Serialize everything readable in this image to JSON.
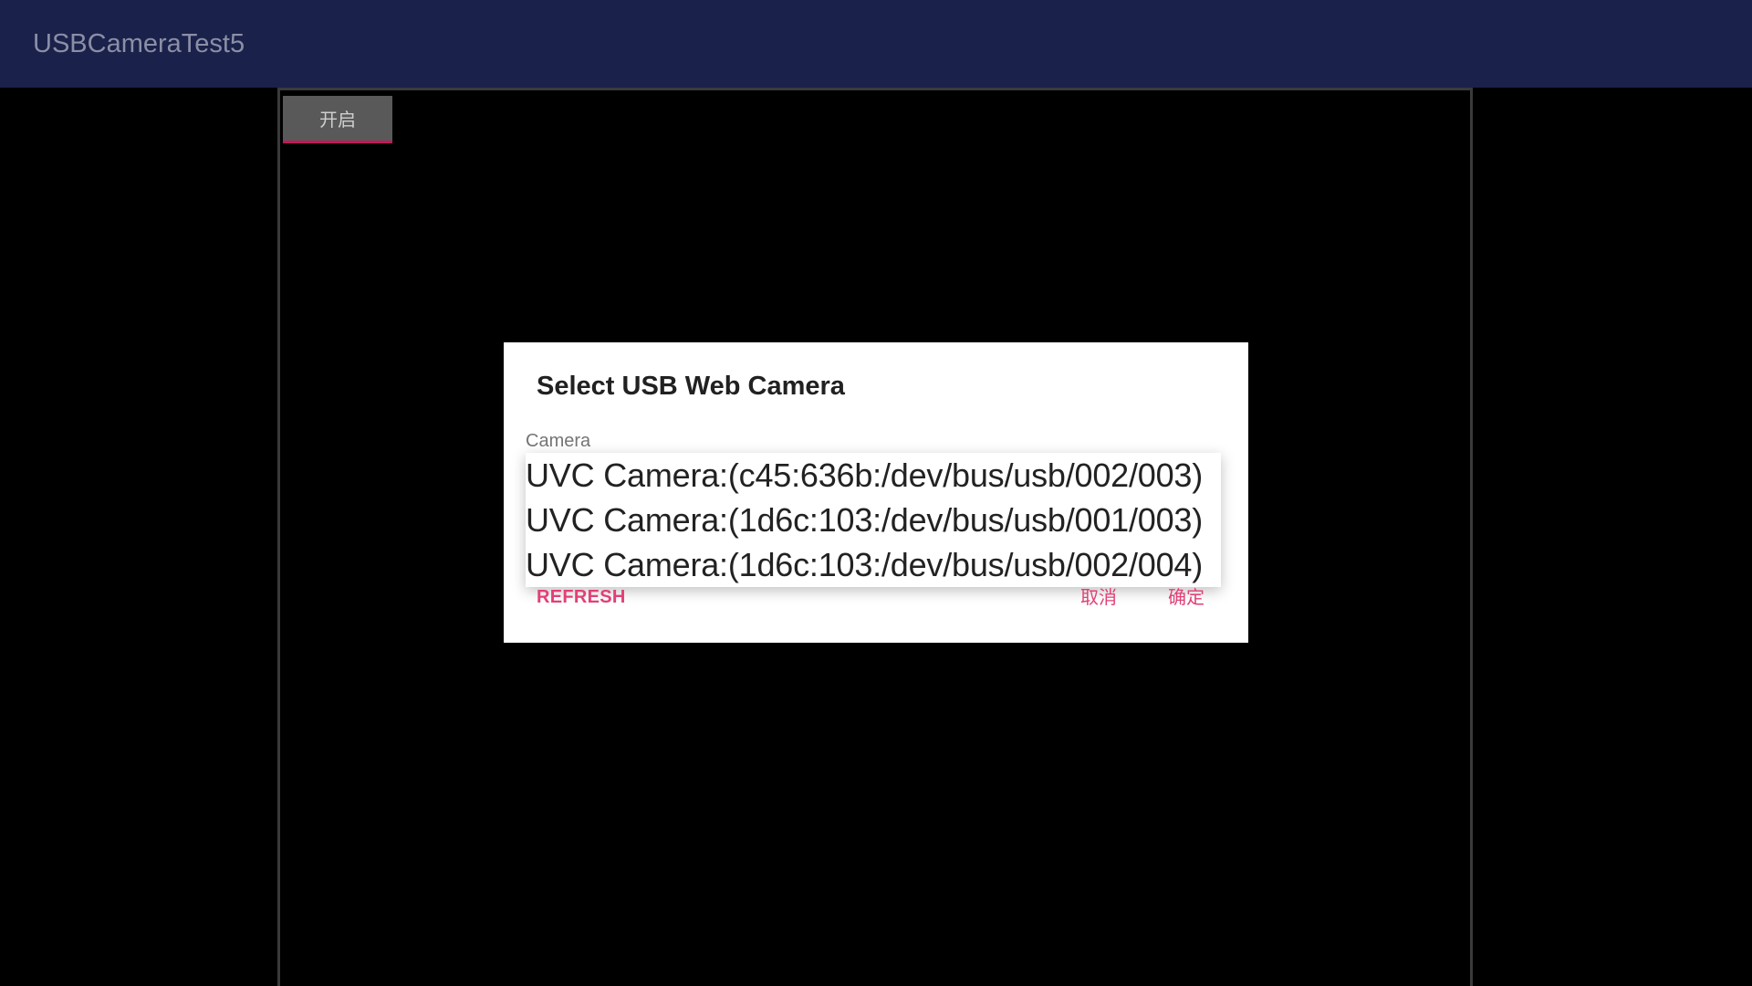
{
  "app_bar": {
    "title": "USBCameraTest5",
    "background_color": "#1a214a"
  },
  "camera_view": {
    "open_button_label": "开启"
  },
  "dialog": {
    "title": "Select USB Web Camera",
    "field_label": "Camera",
    "cameras": [
      "UVC Camera:(c45:636b:/dev/bus/usb/002/003)",
      "UVC Camera:(1d6c:103:/dev/bus/usb/001/003)",
      "UVC Camera:(1d6c:103:/dev/bus/usb/002/004)"
    ],
    "refresh_label": "REFRESH",
    "cancel_label": "取消",
    "ok_label": "确定",
    "accent_color": "#e33f76"
  }
}
